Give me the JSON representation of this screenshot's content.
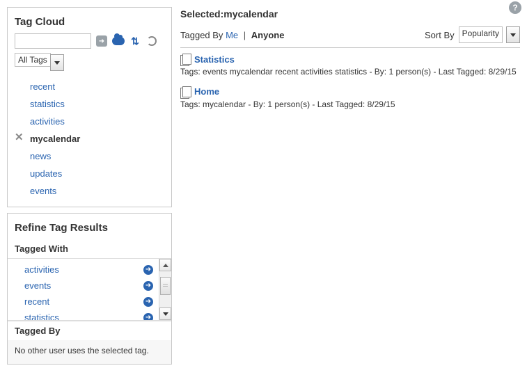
{
  "tagcloud": {
    "title": "Tag Cloud",
    "search_value": "",
    "filter_label": "All Tags",
    "tags": [
      {
        "label": "recent",
        "selected": false
      },
      {
        "label": "statistics",
        "selected": false
      },
      {
        "label": "activities",
        "selected": false
      },
      {
        "label": "mycalendar",
        "selected": true
      },
      {
        "label": "news",
        "selected": false
      },
      {
        "label": "updates",
        "selected": false
      },
      {
        "label": "events",
        "selected": false
      }
    ]
  },
  "refine": {
    "title": "Refine Tag Results",
    "tagged_with_label": "Tagged With",
    "tagged_with": [
      {
        "label": "activities"
      },
      {
        "label": "events"
      },
      {
        "label": "recent"
      },
      {
        "label": "statistics"
      }
    ],
    "tagged_by_label": "Tagged By",
    "tagged_by_empty": "No other user uses the selected tag."
  },
  "main": {
    "selected_prefix": "Selected:",
    "selected_value": "mycalendar",
    "taggedby_label": "Tagged By",
    "taggedby_me": "Me",
    "taggedby_sep": "|",
    "taggedby_anyone": "Anyone",
    "sortby_label": "Sort By",
    "sortby_value": "Popularity",
    "results": [
      {
        "title": "Statistics",
        "meta": "Tags: events mycalendar recent activities statistics - By: 1 person(s) - Last Tagged: 8/29/15"
      },
      {
        "title": "Home",
        "meta": "Tags: mycalendar - By: 1 person(s) - Last Tagged: 8/29/15"
      }
    ]
  }
}
